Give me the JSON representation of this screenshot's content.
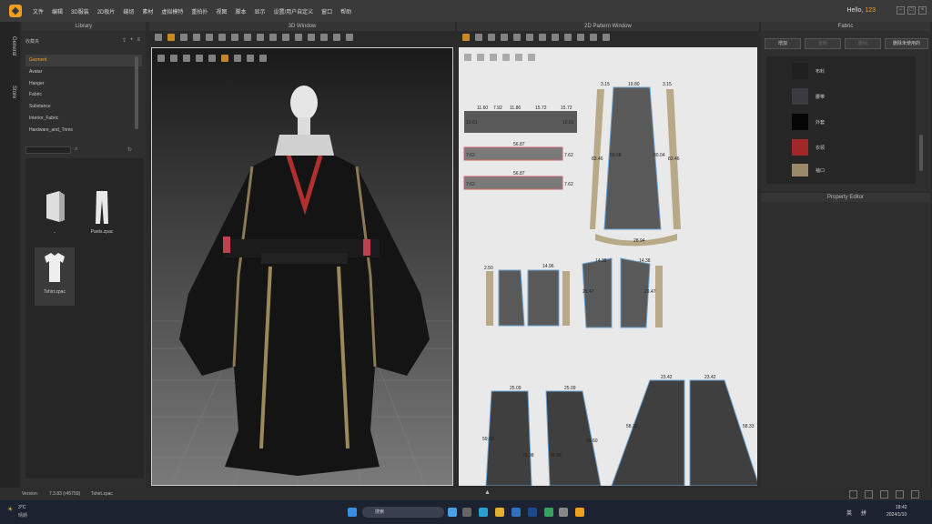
{
  "menubar": {
    "items": [
      "文件",
      "编辑",
      "3D服装",
      "2D板片",
      "缝纫",
      "素材",
      "虚拟模特",
      "重拍扑",
      "视图",
      "脚本",
      "显示",
      "设置/用户自定义",
      "窗口",
      "帮助"
    ],
    "greeting": "Hello,",
    "user": "123"
  },
  "left_tabs": [
    "General",
    "Store"
  ],
  "library": {
    "title": "Library",
    "favorites_label": "收藏夹",
    "items": [
      "Garment",
      "Avatar",
      "Hanger",
      "Fabric",
      "Substance",
      "Interior_Fabric",
      "Hardware_and_Trims"
    ],
    "files": [
      {
        "name": "..",
        "icon": "folder-icon"
      },
      {
        "name": "Pants.zpac",
        "icon": "pants-icon"
      },
      {
        "name": "Tshirt.zpac",
        "icon": "tshirt-icon"
      }
    ]
  },
  "view3d": {
    "title": "3D Window"
  },
  "view2d": {
    "title": "2D Pattern Window",
    "measurements": {
      "m1": "11.60",
      "m2": "7.92",
      "m3": "11.86",
      "m4": "15.72",
      "m5": "15.72",
      "m6": "12.61",
      "m7": "12.61",
      "m8": "56.87",
      "m9": "7.62",
      "m10": "7.62",
      "m11": "56.87",
      "m12": "7.62",
      "m13": "7.62",
      "m14": "19.80",
      "m15": "3.15",
      "m16": "3.15",
      "m17": "83.46",
      "m18": "80.04",
      "m19": "83.46",
      "m20": "59.68",
      "m21": "28.94",
      "m22": "25.09",
      "m23": "25.09",
      "m24": "23.42",
      "m25": "23.42",
      "m26": "59.60",
      "m27": "78.98",
      "m28": "78.98",
      "m29": "59.60",
      "m30": "58.33",
      "m31": "58.33",
      "m32": "14.38",
      "m33": "14.38",
      "m34": "29.47",
      "m35": "29.47",
      "m36": "2.50",
      "m37": "14.96"
    }
  },
  "fabric": {
    "title": "Fabric",
    "buttons": [
      "增加",
      "复制",
      "删除",
      "删除未使用的"
    ],
    "items": [
      {
        "name": "布料",
        "color": "#202020"
      },
      {
        "name": "腰带",
        "color": "#3a3a40"
      },
      {
        "name": "外套",
        "color": "#050505"
      },
      {
        "name": "衣领",
        "color": "#a02828"
      },
      {
        "name": "袖口",
        "color": "#9a8a6a"
      }
    ]
  },
  "property_editor": {
    "title": "Property Editor"
  },
  "statusbar": {
    "version_label": "Version:",
    "version": "7.3.83 (r45759)",
    "file": "Tshirt.zpac"
  },
  "taskbar": {
    "weather_temp": "3°C",
    "weather_desc": "晴朗",
    "search_placeholder": "搜索",
    "lang1": "英",
    "lang2": "拼",
    "time": "18:42",
    "date": "2024/1/10"
  }
}
